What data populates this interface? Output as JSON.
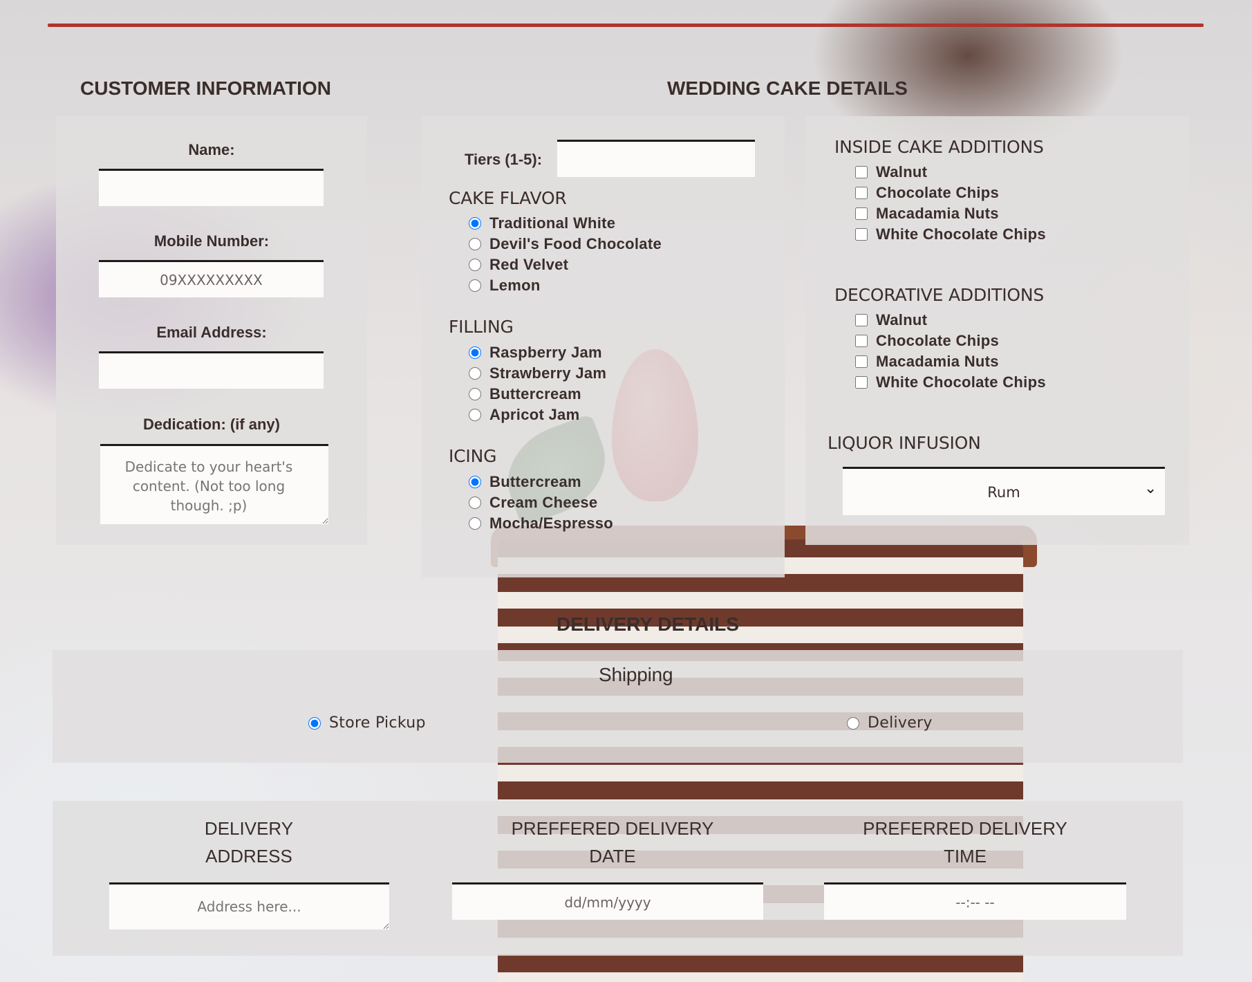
{
  "customer": {
    "title": "CUSTOMER INFORMATION",
    "name_label": "Name:",
    "mobile_label": "Mobile Number:",
    "mobile_placeholder": "09XXXXXXXXX",
    "email_label": "Email Address:",
    "dedication_label": "Dedication: (if any)",
    "dedication_placeholder": "Dedicate to your heart's content. (Not too long though. ;p)"
  },
  "cake": {
    "title": "WEDDING CAKE DETAILS",
    "tiers_label": "Tiers (1-5):",
    "flavor_title": "CAKE FLAVOR",
    "flavors": [
      "Traditional White",
      "Devil's Food Chocolate",
      "Red Velvet",
      "Lemon"
    ],
    "filling_title": "FILLING",
    "fillings": [
      "Raspberry Jam",
      "Strawberry Jam",
      "Buttercream",
      "Apricot Jam"
    ],
    "icing_title": "ICING",
    "icings": [
      "Buttercream",
      "Cream Cheese",
      "Mocha/Espresso"
    ]
  },
  "additions": {
    "inside_title": "INSIDE CAKE ADDITIONS",
    "inside": [
      "Walnut",
      "Chocolate Chips",
      "Macadamia Nuts",
      "White Chocolate Chips"
    ],
    "decorative_title": "DECORATIVE ADDITIONS",
    "decorative": [
      "Walnut",
      "Chocolate Chips",
      "Macadamia Nuts",
      "White Chocolate Chips"
    ],
    "liquor_title": "LIQUOR INFUSION",
    "liquor_selected": "Rum"
  },
  "delivery": {
    "title": "DELIVERY DETAILS",
    "shipping_label": "Shipping",
    "store_pickup": "Store Pickup",
    "delivery_option": "Delivery",
    "address_title_1": "DELIVERY",
    "address_title_2": "ADDRESS",
    "address_placeholder": "Address here...",
    "date_title_1": "PREFFERED DELIVERY",
    "date_title_2": "DATE",
    "date_placeholder": "dd/mm/yyyy",
    "time_title_1": "PREFERRED DELIVERY",
    "time_title_2": "TIME",
    "time_placeholder": "--:-- --"
  }
}
